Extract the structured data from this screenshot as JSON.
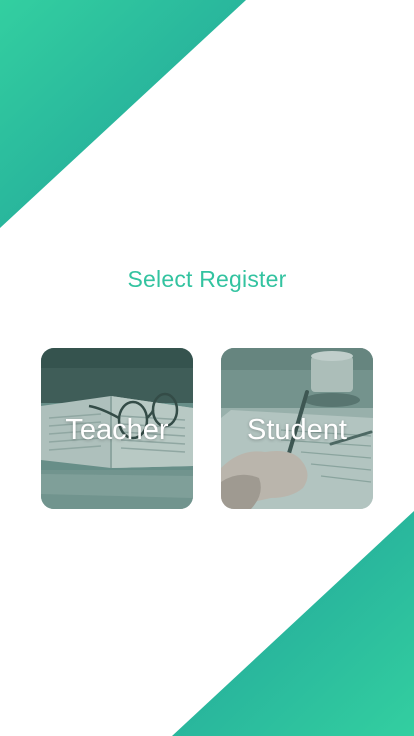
{
  "page": {
    "title": "Select Register"
  },
  "colors": {
    "accent": "#33c3a0",
    "gradient_light": "#33cfa0",
    "gradient_dark": "#1f9e99",
    "card_tint": "#5d8c85"
  },
  "cards": [
    {
      "label": "Teacher",
      "image": "book-and-glasses-photo"
    },
    {
      "label": "Student",
      "image": "hand-writing-photo"
    }
  ]
}
